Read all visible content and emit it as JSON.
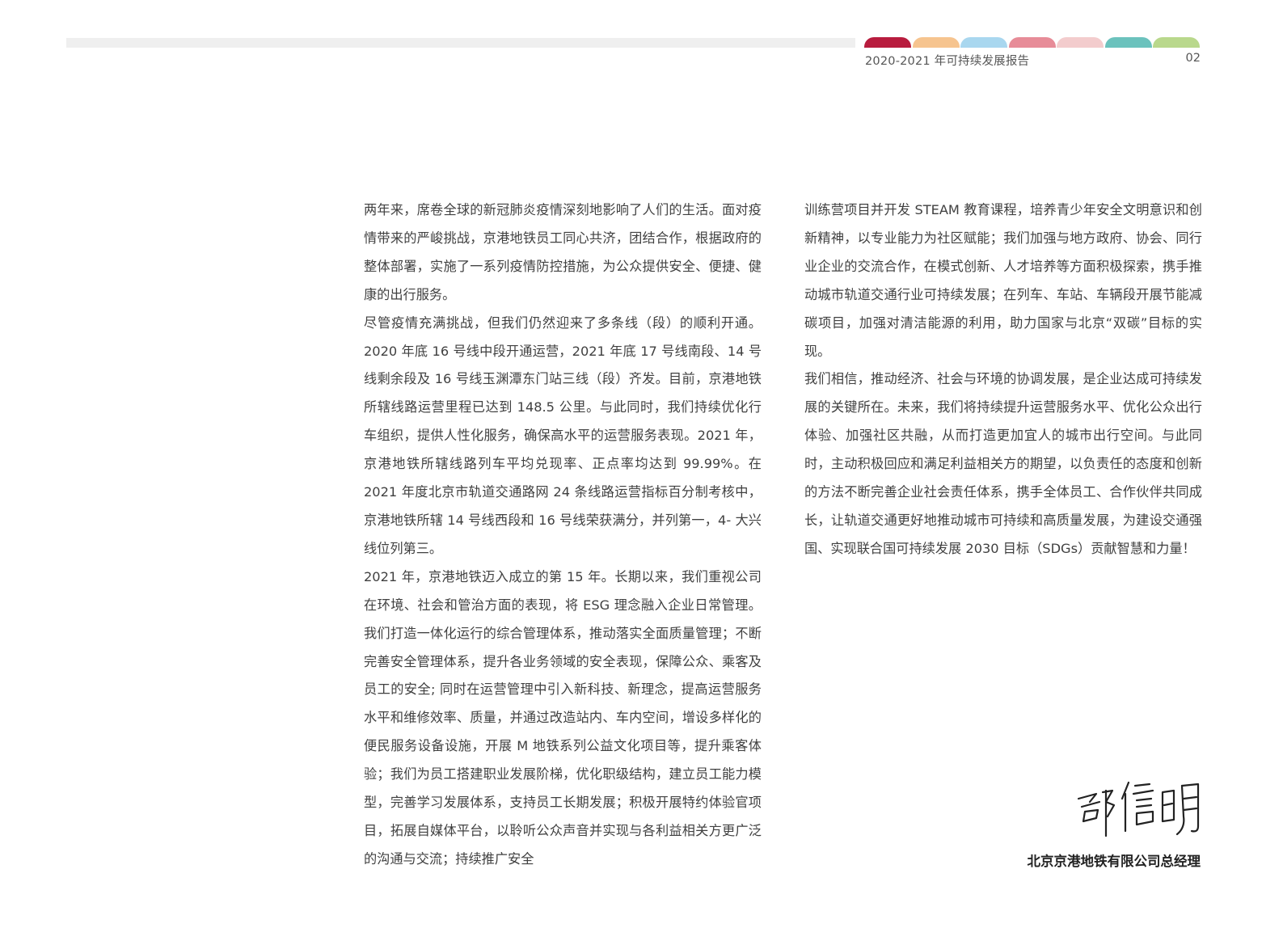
{
  "header": {
    "report_title": "2020-2021 年可持续发展报告",
    "page_number": "02",
    "tab_colors": [
      "#b81c3e",
      "#f6c48f",
      "#a9d7ef",
      "#e78c98",
      "#f3cccd",
      "#6bc2bd",
      "#b9d88c"
    ],
    "bar_color": "#efefef"
  },
  "body": {
    "left_paragraphs": [
      "两年来，席卷全球的新冠肺炎疫情深刻地影响了人们的生活。面对疫情带来的严峻挑战，京港地铁员工同心共济，团结合作，根据政府的整体部署，实施了一系列疫情防控措施，为公众提供安全、便捷、健康的出行服务。",
      "尽管疫情充满挑战，但我们仍然迎来了多条线（段）的顺利开通。2020 年底 16 号线中段开通运营，2021 年底 17 号线南段、14 号线剩余段及 16 号线玉渊潭东门站三线（段）齐发。目前，京港地铁所辖线路运营里程已达到 148.5 公里。与此同时，我们持续优化行车组织，提供人性化服务，确保高水平的运营服务表现。2021 年，京港地铁所辖线路列车平均兑现率、正点率均达到 99.99%。在 2021 年度北京市轨道交通路网 24 条线路运营指标百分制考核中，京港地铁所辖 14 号线西段和 16 号线荣获满分，并列第一，4- 大兴线位列第三。",
      "2021 年，京港地铁迈入成立的第 15 年。长期以来，我们重视公司在环境、社会和管治方面的表现，将 ESG 理念融入企业日常管理。我们打造一体化运行的综合管理体系，推动落实全面质量管理；不断完善安全管理体系，提升各业务领域的安全表现，保障公众、乘客及员工的安全; 同时在运营管理中引入新科技、新理念，提高运营服务水平和维修效率、质量，并通过改造站内、车内空间，增设多样化的便民服务设备设施，开展 M 地铁系列公益文化项目等，提升乘客体验；我们为员工搭建职业发展阶梯，优化职级结构，建立员工能力模型，完善学习发展体系，支持员工长期发展；积极开展特约体验官项目，拓展自媒体平台，以聆听公众声音并实现与各利益相关方更广泛的沟通与交流；持续推广安全"
    ],
    "right_paragraphs": [
      "训练营项目并开发 STEAM 教育课程，培养青少年安全文明意识和创新精神，以专业能力为社区赋能；我们加强与地方政府、协会、同行业企业的交流合作，在模式创新、人才培养等方面积极探索，携手推动城市轨道交通行业可持续发展；在列车、车站、车辆段开展节能减碳项目，加强对清洁能源的利用，助力国家与北京“双碳”目标的实现。",
      "我们相信，推动经济、社会与环境的协调发展，是企业达成可持续发展的关键所在。未来，我们将持续提升运营服务水平、优化公众出行体验、加强社区共融，从而打造更加宜人的城市出行空间。与此同时，主动积极回应和满足利益相关方的期望，以负责任的态度和创新的方法不断完善企业社会责任体系，携手全体员工、合作伙伴共同成长，让轨道交通更好地推动城市可持续和高质量发展，为建设交通强国、实现联合国可持续发展 2030 目标（SDGs）贡献智慧和力量！"
    ]
  },
  "signature": {
    "handwritten_name": "邵信明",
    "title": "北京京港地铁有限公司总经理"
  }
}
